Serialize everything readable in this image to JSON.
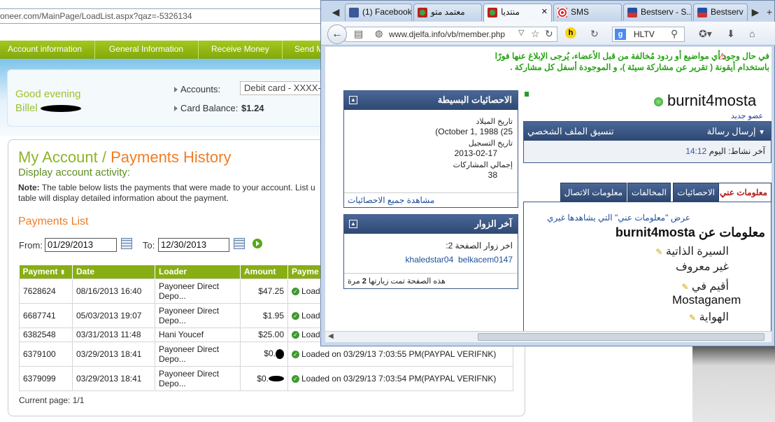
{
  "back": {
    "url": "oneer.com/MainPage/LoadList.aspx?qaz=-5326134",
    "nav": [
      "Account information",
      "General Information",
      "Receive Money",
      "Send M"
    ],
    "greeting": "Good evening",
    "greeting_name": "Billel",
    "accounts_label": "Accounts:",
    "account_value": "Debit card - XXXX-",
    "balance_label": "Card Balance:",
    "balance_value": "$1.24",
    "title_a": "My Account",
    "title_sep": "/",
    "title_b": "Payments History",
    "subtitle": "Display account activity:",
    "note_bold": "Note:",
    "note_text": " The table below lists the payments that were made to your account. List u",
    "note_text2": "table will display detailed information about the payment.",
    "list_title": "Payments List",
    "from_label": "From:",
    "from_value": "01/29/2013",
    "to_label": "To:",
    "to_value": "12/30/2013",
    "columns": [
      "Payment",
      "Date",
      "Loader",
      "Amount",
      "Payme"
    ],
    "rows": [
      {
        "id": "7628624",
        "date": "08/16/2013 16:40",
        "loader1": "Payoneer Direct",
        "loader2": "Depo...",
        "amount": "$47.25",
        "status": "Load"
      },
      {
        "id": "6687741",
        "date": "05/03/2013 19:07",
        "loader1": "Payoneer Direct",
        "loader2": "Depo...",
        "amount": "$1.95",
        "status": "Load"
      },
      {
        "id": "6382548",
        "date": "03/31/2013 11:48",
        "loader1": "Hani Youcef",
        "loader2": "",
        "amount": "$25.00",
        "status": "Load"
      },
      {
        "id": "6379100",
        "date": "03/29/2013 18:41",
        "loader1": "Payoneer Direct",
        "loader2": "Depo...",
        "amount": "$0.",
        "status": "Loaded on 03/29/13 7:03:55 PM(PAYPAL VERIFNK)"
      },
      {
        "id": "6379099",
        "date": "03/29/2013 18:41",
        "loader1": "Payoneer Direct",
        "loader2": "Depo...",
        "amount": "$0.",
        "status": "Loaded on 03/29/13 7:03:54 PM(PAYPAL VERIFNK)"
      }
    ],
    "current_page": "Current page: 1/1"
  },
  "front": {
    "tabs": [
      "(1) Facebook",
      "معتمد متو",
      "منتديا",
      "SMS",
      "Bestserv - S...",
      "Bestserv"
    ],
    "url": "www.djelfa.info/vb/member.php",
    "search_value": "HLTV",
    "warning": "في حال وجود أي مواضيع أو ردود مُخالفة من قبل الأعضاء، يُرجى الإبلاغ عنها فورًا باستخدام أيقونة ( تقرير عن مشاركة سيئة )، و الموجودة أسفل كل مشاركة .",
    "stats_title": "الاحصائيات البسيطة",
    "birth_label": "تاريخ الميلاد",
    "birth_value": "(October 1, 1988 (25",
    "reg_label": "تاريخ التسجيل",
    "reg_value": "2013-02-17",
    "posts_label": "إجمالي المشاركات",
    "posts_value": "38",
    "all_stats_link": "مشاهدة جميع الاحصائيات",
    "visitors_title": "آخر الزوار",
    "visitors_label": "اخر زوار الصفحة 2:",
    "visitor1": "khaledstar04",
    "visitor2": "belkacem0147",
    "visits_text": "هذه الصفحة تمت زيارتها",
    "visits_count": "2",
    "visits_unit": "مرة",
    "username": "burnit4mosta",
    "member_type": "عضو جديد",
    "send_msg": "إرسال رسالة",
    "profile_fmt": "تنسيق الملف الشخصي",
    "last_activity_label": "آخر نشاط:",
    "last_activity_day": "اليوم",
    "last_activity_time": "14:12",
    "tabs_profile": [
      "معلومات عني",
      "الاحصائيات",
      "المخالفات",
      "معلومات الاتصال"
    ],
    "about_link": "عرض \"معلومات عني\" التي يشاهدها غيري",
    "about_title": "معلومات عن",
    "bio_label": "السيرة الذاتية",
    "bio_value": "غير معروف",
    "location_label": "أقيم في",
    "location_value": "Mostaganem",
    "hobby_label": "الهواية"
  }
}
